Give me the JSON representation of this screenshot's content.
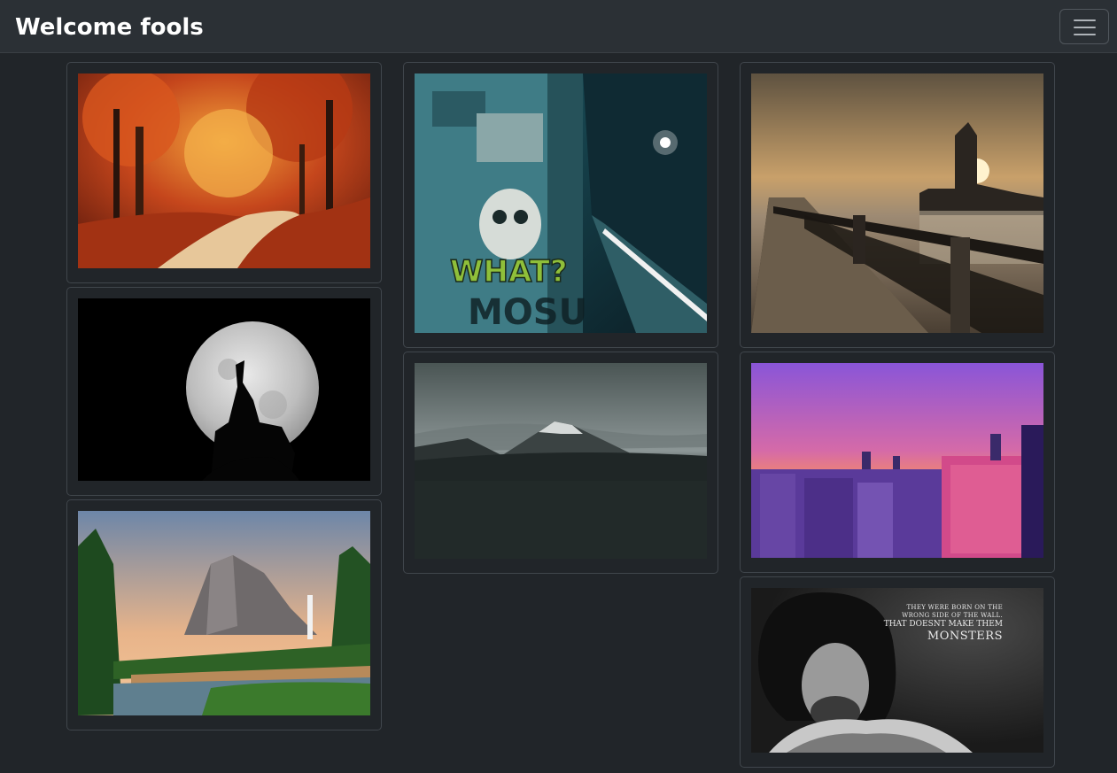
{
  "navbar": {
    "brand": "Welcome fools",
    "toggler_icon": "hamburger-menu-icon"
  },
  "gallery": {
    "images": [
      {
        "name": "autumn-forest-path-image"
      },
      {
        "name": "wolf-howling-moon-image"
      },
      {
        "name": "waterfall-valley-image"
      },
      {
        "name": "graffiti-alley-night-image"
      },
      {
        "name": "mountain-lake-dusk-image"
      },
      {
        "name": "river-promenade-castle-image"
      },
      {
        "name": "city-skyline-sunset-image"
      },
      {
        "name": "portrait-quote-image"
      }
    ],
    "graffiti_text": "WHAT?",
    "quote": {
      "line1": "THEY WERE BORN ON THE",
      "line2": "WRONG SIDE OF THE WALL.",
      "line3": "THAT DOESNT MAKE THEM",
      "line4": "MONSTERS"
    }
  },
  "colors": {
    "background": "#212529",
    "navbar": "#2b3035",
    "card_border": "#40464c"
  }
}
